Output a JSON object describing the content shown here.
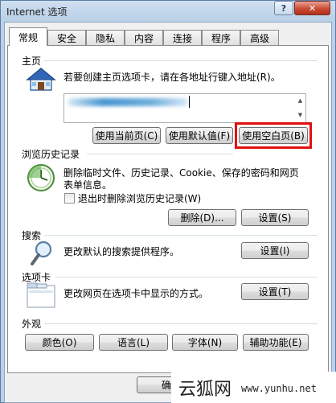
{
  "window": {
    "title": "Internet 选项"
  },
  "tabs": [
    {
      "label": "常规",
      "active": true
    },
    {
      "label": "安全"
    },
    {
      "label": "隐私"
    },
    {
      "label": "内容"
    },
    {
      "label": "连接"
    },
    {
      "label": "程序"
    },
    {
      "label": "高级"
    }
  ],
  "homepage": {
    "title": "主页",
    "description": "若要创建主页选项卡，请在各地址行键入地址(R)。",
    "buttons": {
      "use_current": "使用当前页(C)",
      "use_default": "使用默认值(F)",
      "use_blank": "使用空白页(B)"
    }
  },
  "history": {
    "title": "浏览历史记录",
    "description_line1": "删除临时文件、历史记录、Cookie、保存的密码和网页",
    "description_line2": "表单信息。",
    "checkbox_label": "退出时删除浏览历史记录(W)",
    "checkbox_checked": false,
    "delete_button": "删除(D)...",
    "settings_button": "设置(S)"
  },
  "search": {
    "title": "搜索",
    "description": "更改默认的搜索提供程序。",
    "settings_button": "设置(I)"
  },
  "tabs_section": {
    "title": "选项卡",
    "description": "更改网页在选项卡中显示的方式。",
    "settings_button": "设置(T)"
  },
  "appearance": {
    "title": "外观",
    "buttons": {
      "colors": "颜色(O)",
      "languages": "语言(L)",
      "fonts": "字体(N)",
      "accessibility": "辅助功能(E)"
    }
  },
  "bottom_buttons": {
    "ok_partial": "确"
  },
  "watermark": {
    "cn": "云狐网",
    "url": "www.yunhu.net"
  },
  "colors": {
    "highlight": "#e01010",
    "close_button": "#c94a32"
  }
}
